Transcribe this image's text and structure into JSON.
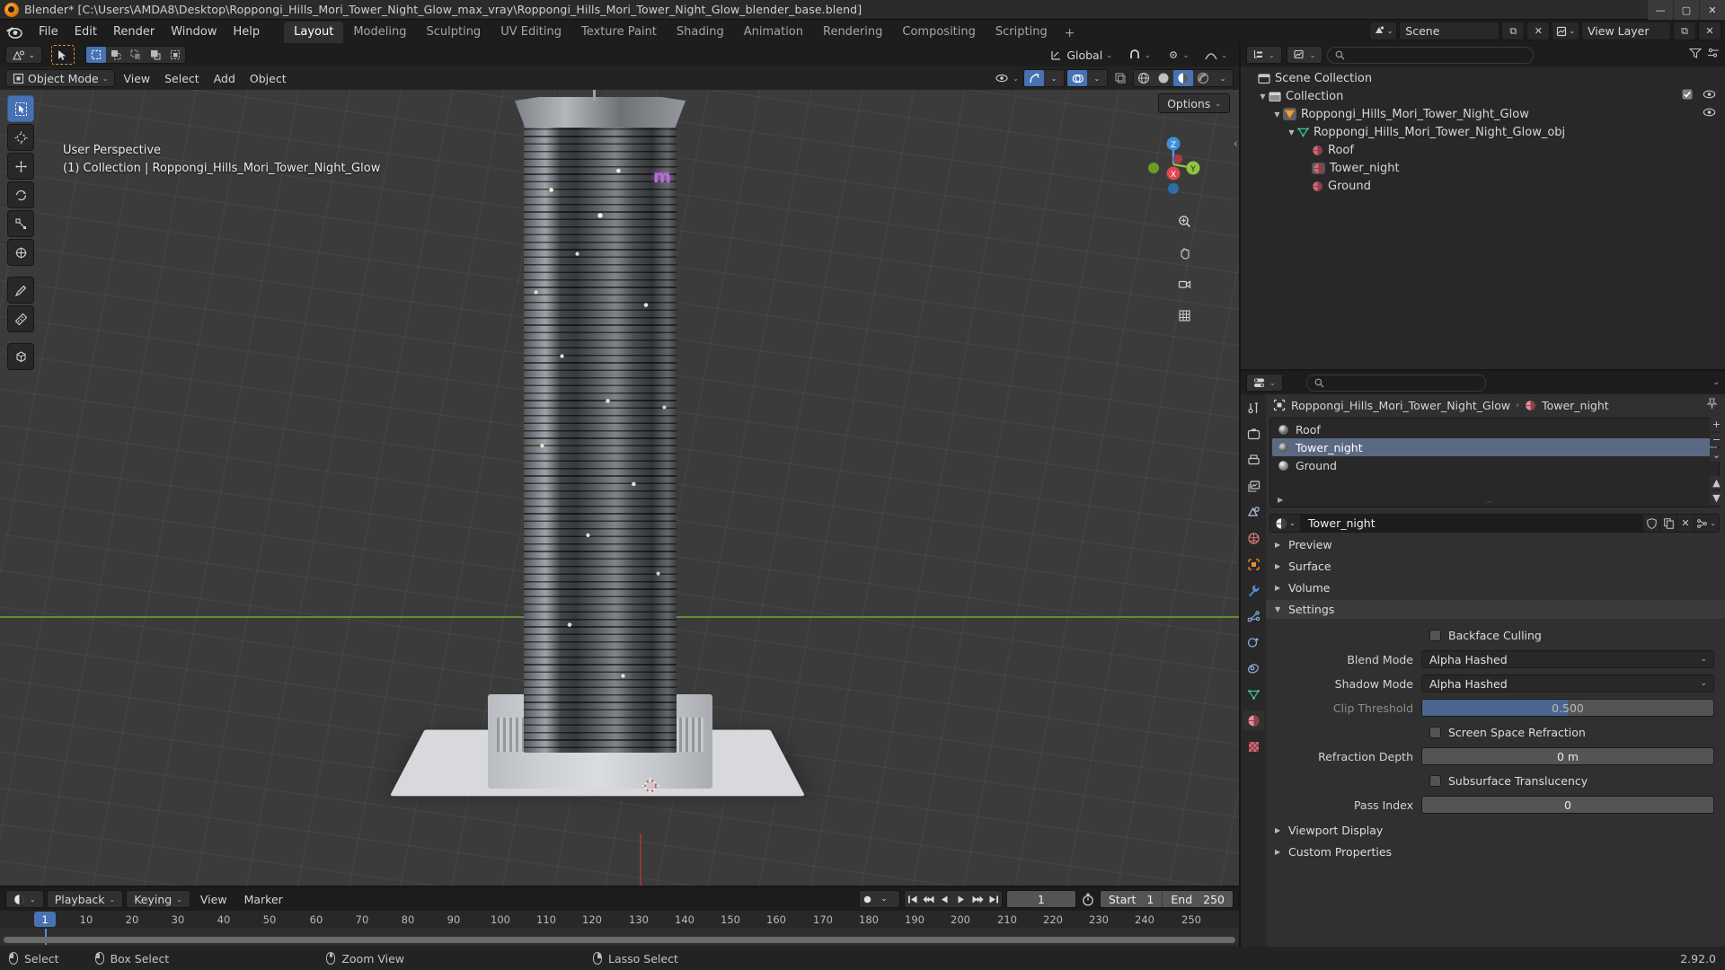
{
  "window": {
    "title": "Blender* [C:\\Users\\AMDA8\\Desktop\\Roppongi_Hills_Mori_Tower_Night_Glow_max_vray\\Roppongi_Hills_Mori_Tower_Night_Glow_blender_base.blend]",
    "minimize": "—",
    "maximize": "▢",
    "close": "✕",
    "app_icon": "blender-logo-icon"
  },
  "topbar": {
    "menus": [
      "File",
      "Edit",
      "Render",
      "Window",
      "Help"
    ],
    "workspaces": [
      {
        "label": "Layout",
        "active": true
      },
      {
        "label": "Modeling",
        "active": false
      },
      {
        "label": "Sculpting",
        "active": false
      },
      {
        "label": "UV Editing",
        "active": false
      },
      {
        "label": "Texture Paint",
        "active": false
      },
      {
        "label": "Shading",
        "active": false
      },
      {
        "label": "Animation",
        "active": false
      },
      {
        "label": "Rendering",
        "active": false
      },
      {
        "label": "Compositing",
        "active": false
      },
      {
        "label": "Scripting",
        "active": false
      }
    ],
    "add_workspace": "+",
    "scene_name": "Scene",
    "view_layer_name": "View Layer",
    "scene_icon": "scene-icon",
    "viewlayer_icon": "view-layer-icon",
    "new_scene_icon": "new-icon",
    "remove_scene_icon": "x-icon"
  },
  "viewport": {
    "tools_row": {
      "editor_type_icon": "editor-type-icon",
      "cursor_tool_icon": "tweak-cursor-icon",
      "select_modes": [
        "set-select-icon",
        "extend-select-icon",
        "subtract-select-icon",
        "invert-select-icon",
        "intersect-select-icon"
      ],
      "transform_orientation": "Global",
      "orientation_icon": "orientation-icon",
      "snap_icon": "magnet-icon",
      "pivot_icon": "pivot-icon",
      "proportional_icon": "proportional-edit-icon"
    },
    "header": {
      "mode": "Object Mode",
      "mode_icon": "object-mode-icon",
      "menus": [
        "View",
        "Select",
        "Add",
        "Object"
      ],
      "visibility_icon": "eye-icon",
      "gizmo_icon": "gizmo-icon",
      "overlays_icon": "overlays-icon",
      "xray_icon": "xray-icon",
      "shading_modes": [
        "wireframe-icon",
        "solid-icon",
        "material-preview-icon",
        "rendered-icon"
      ],
      "active_shading": 2,
      "options_label": "Options"
    },
    "toolbar": [
      "tweak-select-tool-icon",
      "cursor-tool-icon",
      "move-tool-icon",
      "rotate-tool-icon",
      "scale-tool-icon",
      "transform-tool-icon",
      "annotate-tool-icon",
      "measure-tool-icon",
      "add-cube-tool-icon"
    ],
    "overlay_text": {
      "line1": "User Perspective",
      "line2": "(1) Collection | Roppongi_Hills_Mori_Tower_Night_Glow"
    },
    "gizmo_axes": [
      "Z",
      "Y",
      "X"
    ],
    "nav_buttons": [
      "zoom-navigate-icon",
      "pan-navigate-icon",
      "camera-view-icon",
      "toggle-ortho-icon"
    ],
    "sidebar_toggle_icon": "chevron-left-icon"
  },
  "outliner": {
    "display_mode_icon": "outliner-display-mode-icon",
    "filter_icon": "filter-icon",
    "search_placeholder": "",
    "search_icon": "search-icon",
    "items": [
      {
        "label": "Scene Collection",
        "icon": "scene-collection-icon",
        "indent": 0,
        "expander": "",
        "checkbox": false,
        "eye": false
      },
      {
        "label": "Collection",
        "icon": "collection-icon",
        "indent": 1,
        "expander": "▼",
        "checkbox": true,
        "eye": true
      },
      {
        "label": "Roppongi_Hills_Mori_Tower_Night_Glow",
        "icon": "empty-object-icon",
        "indent": 2,
        "expander": "▼",
        "checkbox": false,
        "eye": true
      },
      {
        "label": "Roppongi_Hills_Mori_Tower_Night_Glow_obj",
        "icon": "mesh-data-icon",
        "indent": 3,
        "expander": "▼",
        "checkbox": false,
        "eye": false
      },
      {
        "label": "Roof",
        "icon": "material-icon",
        "indent": 4,
        "expander": "",
        "checkbox": false,
        "eye": false
      },
      {
        "label": "Tower_night",
        "icon": "material-icon",
        "indent": 4,
        "expander": "",
        "checkbox": false,
        "eye": false,
        "highlighted": true
      },
      {
        "label": "Ground",
        "icon": "material-icon",
        "indent": 4,
        "expander": "",
        "checkbox": false,
        "eye": false
      }
    ]
  },
  "properties": {
    "editor_icon": "properties-editor-icon",
    "search_placeholder": "",
    "search_icon": "search-icon",
    "tabs": [
      {
        "name": "tool-tab",
        "icon": "tool-icon",
        "active": false
      },
      {
        "name": "render-tab",
        "icon": "render-icon",
        "active": false
      },
      {
        "name": "output-tab",
        "icon": "printer-icon",
        "active": false
      },
      {
        "name": "view-layer-tab",
        "icon": "images-icon",
        "active": false
      },
      {
        "name": "scene-tab",
        "icon": "scene-props-icon",
        "active": false
      },
      {
        "name": "world-tab",
        "icon": "world-icon",
        "active": false
      },
      {
        "name": "object-tab",
        "icon": "object-props-icon",
        "active": false
      },
      {
        "name": "modifier-tab",
        "icon": "wrench-icon",
        "active": false
      },
      {
        "name": "particles-tab",
        "icon": "particles-icon",
        "active": false
      },
      {
        "name": "physics-tab",
        "icon": "physics-icon",
        "active": false
      },
      {
        "name": "constraints-tab",
        "icon": "constraints-icon",
        "active": false
      },
      {
        "name": "data-tab",
        "icon": "mesh-data-icon",
        "active": false
      },
      {
        "name": "material-tab",
        "icon": "material-icon",
        "active": true
      },
      {
        "name": "texture-tab",
        "icon": "texture-icon",
        "active": false
      }
    ],
    "breadcrumb": {
      "object": "Roppongi_Hills_Mori_Tower_Night_Glow",
      "object_icon": "object-props-icon",
      "material": "Tower_night",
      "material_icon": "material-icon",
      "separator": "›",
      "pin_icon": "pin-icon"
    },
    "material_slots": [
      {
        "label": "Roof",
        "selected": false
      },
      {
        "label": "Tower_night",
        "selected": true
      },
      {
        "label": "Ground",
        "selected": false
      }
    ],
    "slot_buttons": [
      "+",
      "−",
      "⌄"
    ],
    "slot_extra_buttons": [
      "▲",
      "▼"
    ],
    "material_field": {
      "browse_icon": "material-browse-icon",
      "value": "Tower_night",
      "fake_user_icon": "shield-icon",
      "copy_icon": "copy-icon",
      "unlink_icon": "x-icon",
      "node_icon": "node-icon"
    },
    "panels": [
      {
        "label": "Preview",
        "open": false
      },
      {
        "label": "Surface",
        "open": false
      },
      {
        "label": "Volume",
        "open": false
      },
      {
        "label": "Settings",
        "open": true
      }
    ],
    "settings": {
      "backface_culling": {
        "label": "Backface Culling",
        "checked": false
      },
      "blend_mode": {
        "label": "Blend Mode",
        "value": "Alpha Hashed"
      },
      "shadow_mode": {
        "label": "Shadow Mode",
        "value": "Alpha Hashed"
      },
      "clip_threshold": {
        "label": "Clip Threshold",
        "value": "0.500",
        "fill_percent": 50,
        "disabled": true
      },
      "screen_space_refraction": {
        "label": "Screen Space Refraction",
        "checked": false
      },
      "refraction_depth": {
        "label": "Refraction Depth",
        "value": "0 m"
      },
      "subsurface_translucency": {
        "label": "Subsurface Translucency",
        "checked": false
      },
      "pass_index": {
        "label": "Pass Index",
        "value": "0"
      }
    },
    "footer_panels": [
      {
        "label": "Viewport Display",
        "open": false
      },
      {
        "label": "Custom Properties",
        "open": false
      }
    ]
  },
  "timeline": {
    "editor_icon": "timeline-editor-icon",
    "menus": [
      "Playback",
      "Keying",
      "View",
      "Marker"
    ],
    "menus_boxed": [
      true,
      true,
      false,
      false
    ],
    "record_icon": "record-icon",
    "transport": [
      "jump-start-icon",
      "prev-keyframe-icon",
      "play-reverse-icon",
      "play-icon",
      "next-keyframe-icon",
      "jump-end-icon"
    ],
    "current_frame": "1",
    "sync_icon": "stopwatch-icon",
    "start_label": "Start",
    "start_value": "1",
    "end_label": "End",
    "end_value": "250",
    "ticks": [
      "10",
      "20",
      "30",
      "40",
      "50",
      "60",
      "70",
      "80",
      "90",
      "100",
      "110",
      "120",
      "130",
      "140",
      "150",
      "160",
      "170",
      "180",
      "190",
      "200",
      "210",
      "220",
      "230",
      "240",
      "250"
    ],
    "playhead_label": "1"
  },
  "statusbar": {
    "items": [
      {
        "label": "Select",
        "mouse": "l"
      },
      {
        "label": "Box Select",
        "mouse": "l"
      },
      {
        "label": "Zoom View",
        "mouse": "m"
      },
      {
        "label": "Lasso Select",
        "mouse": "r"
      }
    ],
    "version": "2.92.0"
  },
  "colors": {
    "accent_blue": "#4772b3",
    "selection": "#5b6a82",
    "axis_green": "#6b9c2e",
    "axis_red": "#9c3a3a",
    "material_red": "#d06a76",
    "mesh_green": "#3ec49a",
    "empty_orange": "#e8922f"
  }
}
